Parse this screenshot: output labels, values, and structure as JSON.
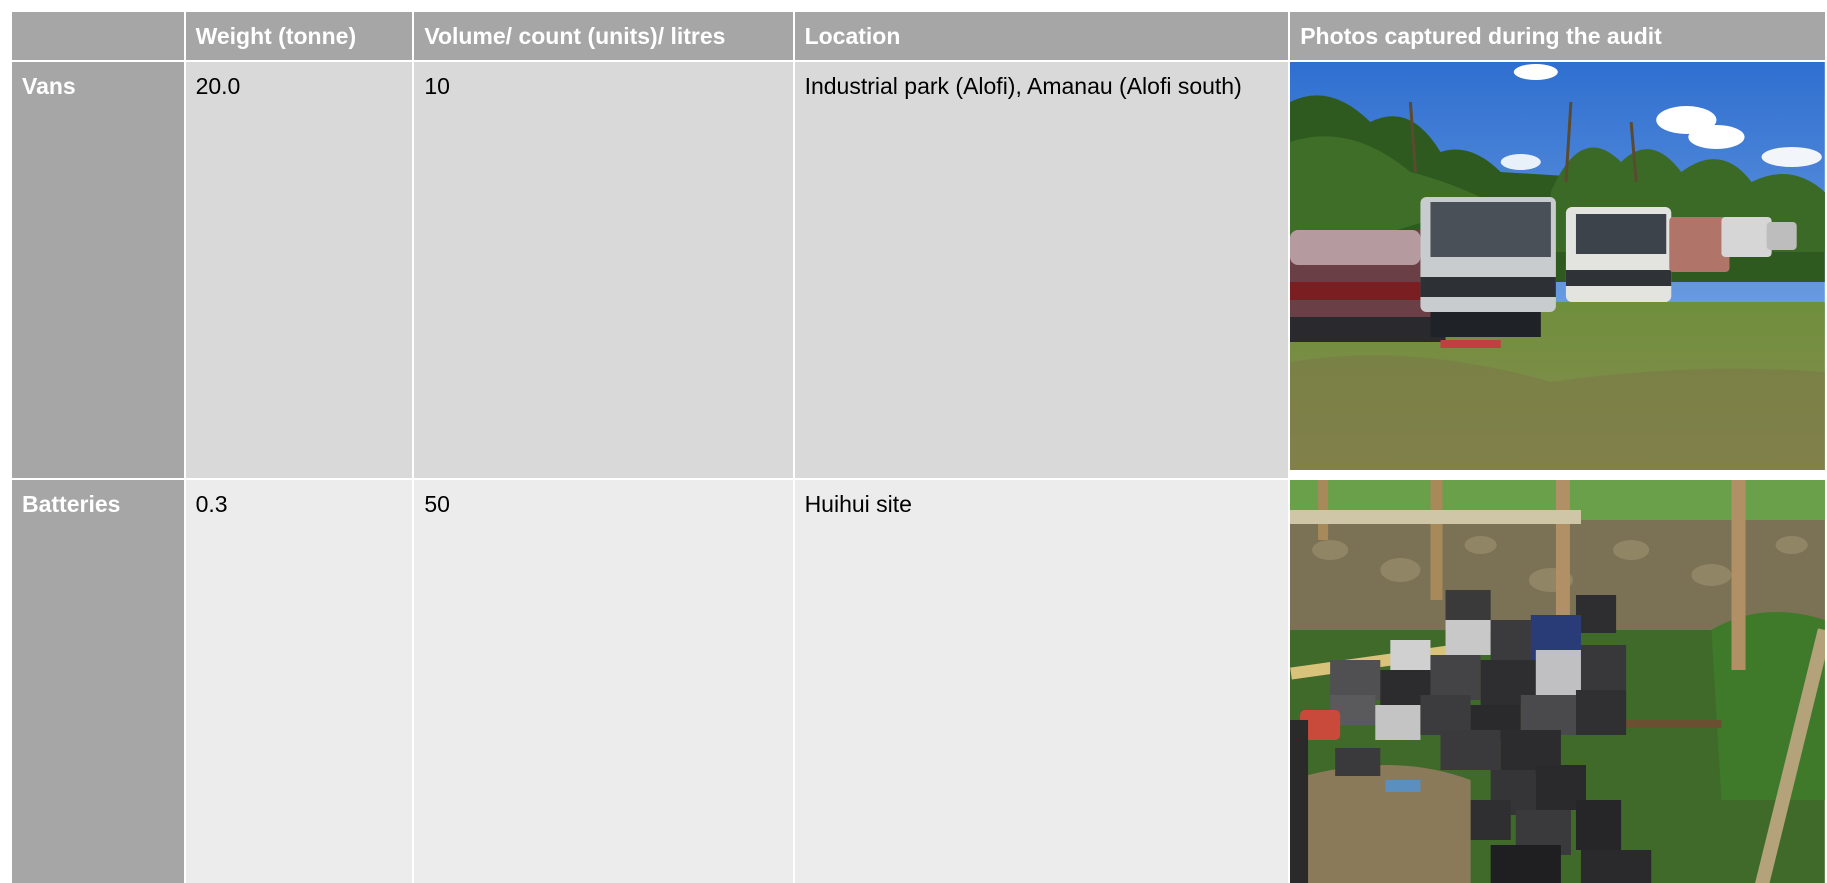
{
  "columns": {
    "blank": "",
    "weight": "Weight (tonne)",
    "volume": "Volume/ count (units)/ litres",
    "location": "Location",
    "photos": "Photos captured during the audit"
  },
  "rows": [
    {
      "item": "Vans",
      "weight": "20.0",
      "volume": "10",
      "location": "Industrial park (Alofi), Amanau (Alofi south)",
      "photo_icon": "vehicles-photo"
    },
    {
      "item": "Batteries",
      "weight": "0.3",
      "volume": "50",
      "location": "Huihui site",
      "photo_icon": "batteries-photo"
    }
  ],
  "colors": {
    "header_bg": "#a6a6a6",
    "row1_bg": "#d9d9d9",
    "row2_bg": "#ececec"
  }
}
